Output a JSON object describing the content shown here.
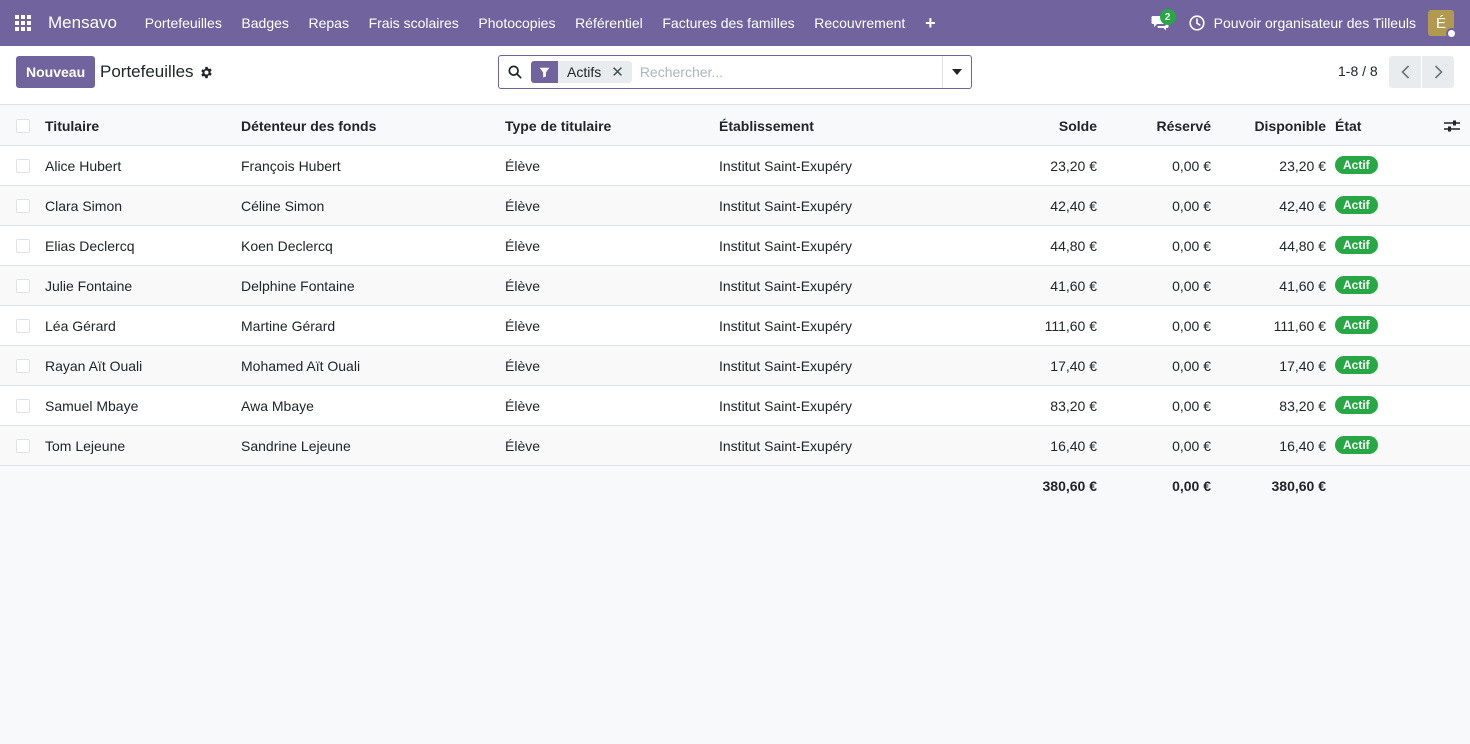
{
  "navbar": {
    "brand": "Mensavo",
    "menu": [
      "Portefeuilles",
      "Badges",
      "Repas",
      "Frais scolaires",
      "Photocopies",
      "Référentiel",
      "Factures des familles",
      "Recouvrement"
    ],
    "plus": "+",
    "chat_count": "2",
    "company": "Pouvoir organisateur des Tilleuls",
    "avatar_letter": "É"
  },
  "control": {
    "new_label": "Nouveau",
    "title": "Portefeuilles",
    "facet_label": "Actifs",
    "facet_remove": "✕",
    "search_placeholder": "Rechercher...",
    "pager": "1-8 / 8"
  },
  "table": {
    "headers": {
      "name": "Titulaire",
      "holder": "Détenteur des fonds",
      "type": "Type de titulaire",
      "school": "Établissement",
      "solde": "Solde",
      "reserve": "Réservé",
      "dispo": "Disponible",
      "etat": "État"
    },
    "rows": [
      {
        "name": "Alice Hubert",
        "holder": "François Hubert",
        "type": "Élève",
        "school": "Institut Saint-Exupéry",
        "solde": "23,20 €",
        "reserve": "0,00 €",
        "dispo": "23,20 €",
        "etat": "Actif"
      },
      {
        "name": "Clara Simon",
        "holder": "Céline Simon",
        "type": "Élève",
        "school": "Institut Saint-Exupéry",
        "solde": "42,40 €",
        "reserve": "0,00 €",
        "dispo": "42,40 €",
        "etat": "Actif"
      },
      {
        "name": "Elias Declercq",
        "holder": "Koen Declercq",
        "type": "Élève",
        "school": "Institut Saint-Exupéry",
        "solde": "44,80 €",
        "reserve": "0,00 €",
        "dispo": "44,80 €",
        "etat": "Actif"
      },
      {
        "name": "Julie Fontaine",
        "holder": "Delphine Fontaine",
        "type": "Élève",
        "school": "Institut Saint-Exupéry",
        "solde": "41,60 €",
        "reserve": "0,00 €",
        "dispo": "41,60 €",
        "etat": "Actif"
      },
      {
        "name": "Léa Gérard",
        "holder": "Martine Gérard",
        "type": "Élève",
        "school": "Institut Saint-Exupéry",
        "solde": "111,60 €",
        "reserve": "0,00 €",
        "dispo": "111,60 €",
        "etat": "Actif"
      },
      {
        "name": "Rayan Aït Ouali",
        "holder": "Mohamed Aït Ouali",
        "type": "Élève",
        "school": "Institut Saint-Exupéry",
        "solde": "17,40 €",
        "reserve": "0,00 €",
        "dispo": "17,40 €",
        "etat": "Actif"
      },
      {
        "name": "Samuel Mbaye",
        "holder": "Awa Mbaye",
        "type": "Élève",
        "school": "Institut Saint-Exupéry",
        "solde": "83,20 €",
        "reserve": "0,00 €",
        "dispo": "83,20 €",
        "etat": "Actif"
      },
      {
        "name": "Tom Lejeune",
        "holder": "Sandrine Lejeune",
        "type": "Élève",
        "school": "Institut Saint-Exupéry",
        "solde": "16,40 €",
        "reserve": "0,00 €",
        "dispo": "16,40 €",
        "etat": "Actif"
      }
    ],
    "totals": {
      "solde": "380,60 €",
      "reserve": "0,00 €",
      "dispo": "380,60 €"
    }
  },
  "colors": {
    "brand": "#71639e",
    "active_badge": "#28a745"
  },
  "icons": {
    "apps": "apps-grid-icon",
    "chat": "chat-icon",
    "activity": "clock-icon",
    "settings": "gear-icon",
    "search": "search-icon",
    "filter": "filter-icon",
    "columns": "sliders-icon"
  }
}
